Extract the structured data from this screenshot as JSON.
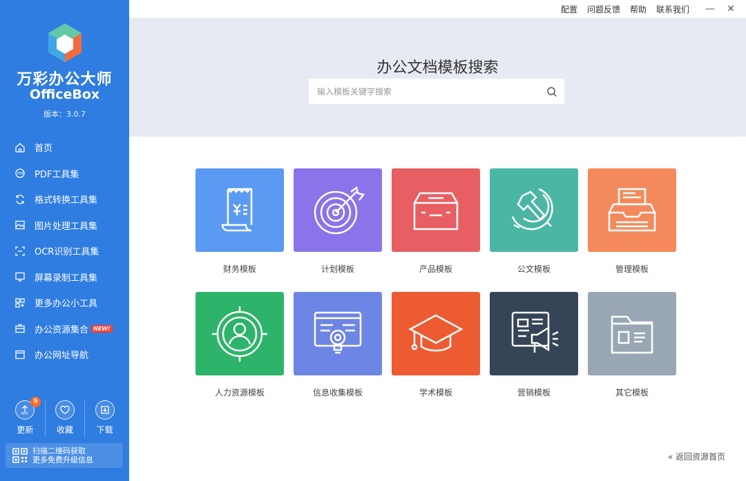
{
  "app": {
    "name": "万彩办公大师",
    "name_en": "OfficeBox",
    "version": "版本：3.0.7"
  },
  "topbar": {
    "links": [
      "配置",
      "问题反馈",
      "帮助",
      "联系我们"
    ],
    "minimize": "—",
    "close": "✕"
  },
  "nav": {
    "items": [
      {
        "label": "首页",
        "icon": "home-icon"
      },
      {
        "label": "PDF工具集",
        "icon": "pdf-icon"
      },
      {
        "label": "格式转换工具集",
        "icon": "convert-icon"
      },
      {
        "label": "图片处理工具集",
        "icon": "image-icon"
      },
      {
        "label": "OCR识别工具集",
        "icon": "ocr-icon"
      },
      {
        "label": "屏幕录制工具集",
        "icon": "monitor-icon"
      },
      {
        "label": "更多办公小工具",
        "icon": "apps-icon"
      },
      {
        "label": "办公资源集合",
        "icon": "briefcase-icon",
        "badge": "NEW!"
      },
      {
        "label": "办公网址导航",
        "icon": "browser-icon"
      }
    ]
  },
  "actions": {
    "update": {
      "label": "更新",
      "count": "5"
    },
    "favorite": {
      "label": "收藏"
    },
    "download": {
      "label": "下载"
    }
  },
  "qr": {
    "line1": "扫描二维码获取",
    "line2": "更多免费升级信息"
  },
  "search": {
    "title": "办公文档模板搜索",
    "placeholder": "输入模板关键字搜索"
  },
  "templates": [
    {
      "label": "财务模板",
      "color": "#5b9af3",
      "icon": "receipt-icon"
    },
    {
      "label": "计划模板",
      "color": "#8b74e9",
      "icon": "target-icon"
    },
    {
      "label": "产品模板",
      "color": "#e75f63",
      "icon": "box-icon"
    },
    {
      "label": "公文模板",
      "color": "#4cb6a5",
      "icon": "emblem-icon"
    },
    {
      "label": "管理模板",
      "color": "#f48a5b",
      "icon": "file-tray-icon"
    },
    {
      "label": "人力资源模板",
      "color": "#2db46a",
      "icon": "person-target-icon"
    },
    {
      "label": "信息收集模板",
      "color": "#6d86e6",
      "icon": "web-search-icon"
    },
    {
      "label": "学术模板",
      "color": "#ed5b33",
      "icon": "mortarboard-icon"
    },
    {
      "label": "营销模板",
      "color": "#354457",
      "icon": "megaphone-icon"
    },
    {
      "label": "其它模板",
      "color": "#98a7b3",
      "icon": "folder-icon"
    }
  ],
  "back_link": "« 返回资源首页"
}
